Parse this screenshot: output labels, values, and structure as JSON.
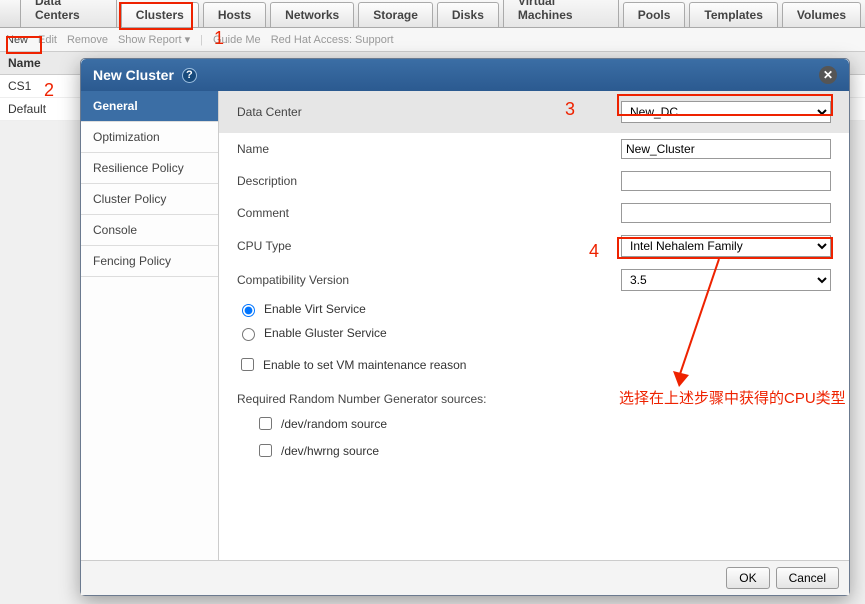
{
  "main_tabs": {
    "t0": "Data Centers",
    "t1": "Clusters",
    "t2": "Hosts",
    "t3": "Networks",
    "t4": "Storage",
    "t5": "Disks",
    "t6": "Virtual Machines",
    "t7": "Pools",
    "t8": "Templates",
    "t9": "Volumes"
  },
  "toolbar": {
    "new": "New",
    "edit": "Edit",
    "remove": "Remove",
    "show_report": "Show Report ▾",
    "guide": "Guide Me",
    "support": "Red Hat Access: Support"
  },
  "list": {
    "header": "Name",
    "row0": "CS1",
    "row1": "Default"
  },
  "dialog": {
    "title": "New Cluster",
    "side": {
      "s0": "General",
      "s1": "Optimization",
      "s2": "Resilience Policy",
      "s3": "Cluster Policy",
      "s4": "Console",
      "s5": "Fencing Policy"
    },
    "labels": {
      "dc": "Data Center",
      "name": "Name",
      "desc": "Description",
      "comment": "Comment",
      "cpu": "CPU Type",
      "compat": "Compatibility Version",
      "virt": "Enable Virt Service",
      "gluster": "Enable Gluster Service",
      "maint": "Enable to set VM maintenance reason",
      "rng": "Required Random Number Generator sources:",
      "rng_rand": "/dev/random source",
      "rng_hw": "/dev/hwrng source"
    },
    "values": {
      "dc": "New_DC",
      "name": "New_Cluster",
      "desc": "",
      "comment": "",
      "cpu": "Intel Nehalem Family",
      "compat": "3.5"
    },
    "buttons": {
      "ok": "OK",
      "cancel": "Cancel"
    }
  },
  "annotations": {
    "m1": "1",
    "m2": "2",
    "m3": "3",
    "m4": "4",
    "note": "选择在上述步骤中获得的CPU类型"
  }
}
